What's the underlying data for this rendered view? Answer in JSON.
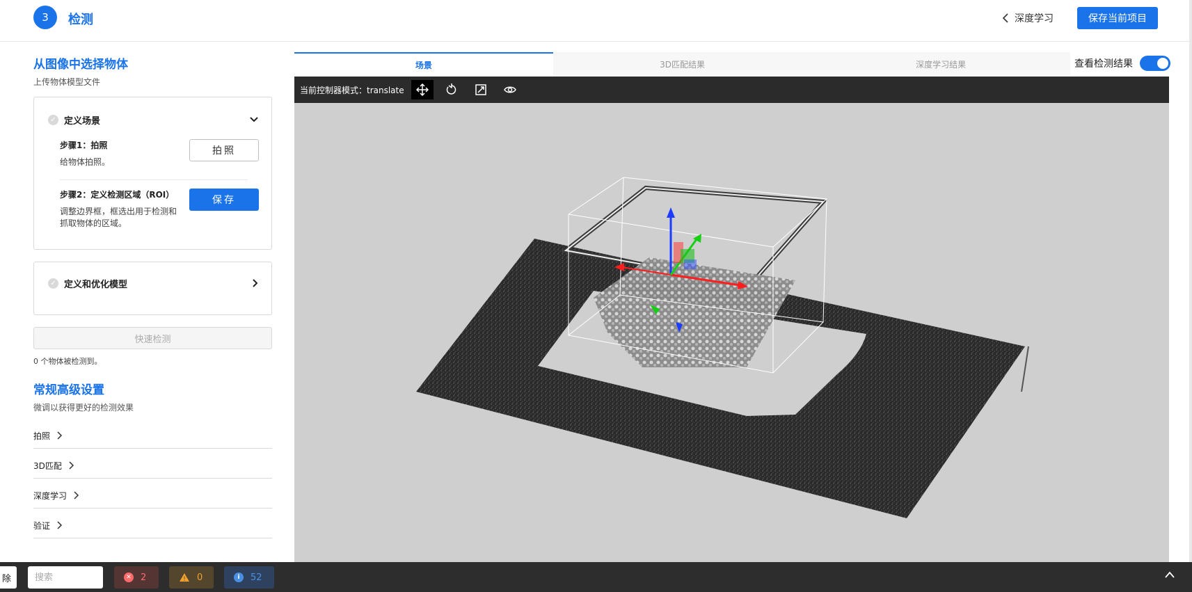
{
  "header": {
    "step_number": "3",
    "title": "检测",
    "back_label": "深度学习",
    "save_project_label": "保存当前项目"
  },
  "left_panel": {
    "section_title": "从图像中选择物体",
    "section_subtitle": "上传物体模型文件",
    "scene_card": {
      "title": "定义场景",
      "step1": {
        "name": "步骤1：拍照",
        "desc": "给物体拍照。",
        "button": "拍照"
      },
      "step2": {
        "name": "步骤2：定义检测区域（ROI）",
        "desc": "调整边界框，框选出用于检测和抓取物体的区域。",
        "button": "保存"
      }
    },
    "model_card": {
      "title": "定义和优化模型"
    },
    "quick_detect_label": "快速检测",
    "detected_count_text": "0 个物体被检测到。",
    "advanced": {
      "title": "常规高级设置",
      "subtitle": "微调以获得更好的检测效果",
      "items": [
        "拍照",
        "3D匹配",
        "深度学习",
        "验证"
      ]
    }
  },
  "tabs": [
    {
      "label": "场景",
      "active": true
    },
    {
      "label": "3D匹配结果",
      "active": false
    },
    {
      "label": "深度学习结果",
      "active": false
    }
  ],
  "toggle": {
    "label": "查看检测结果",
    "on": true
  },
  "toolbar": {
    "mode_label": "当前控制器模式：translate",
    "tools": [
      "move-icon",
      "rotate-icon",
      "scale-icon",
      "eye-icon"
    ]
  },
  "bottom_bar": {
    "clear_label": "除",
    "search_placeholder": "搜索",
    "error_count": "2",
    "warning_count": "0",
    "info_count": "52"
  },
  "colors": {
    "accent": "#1a73e8",
    "viewport_bg": "#cfcfcf",
    "toolbar_bg": "#2b2b2b",
    "bottom_bg": "#2d2d2d"
  }
}
